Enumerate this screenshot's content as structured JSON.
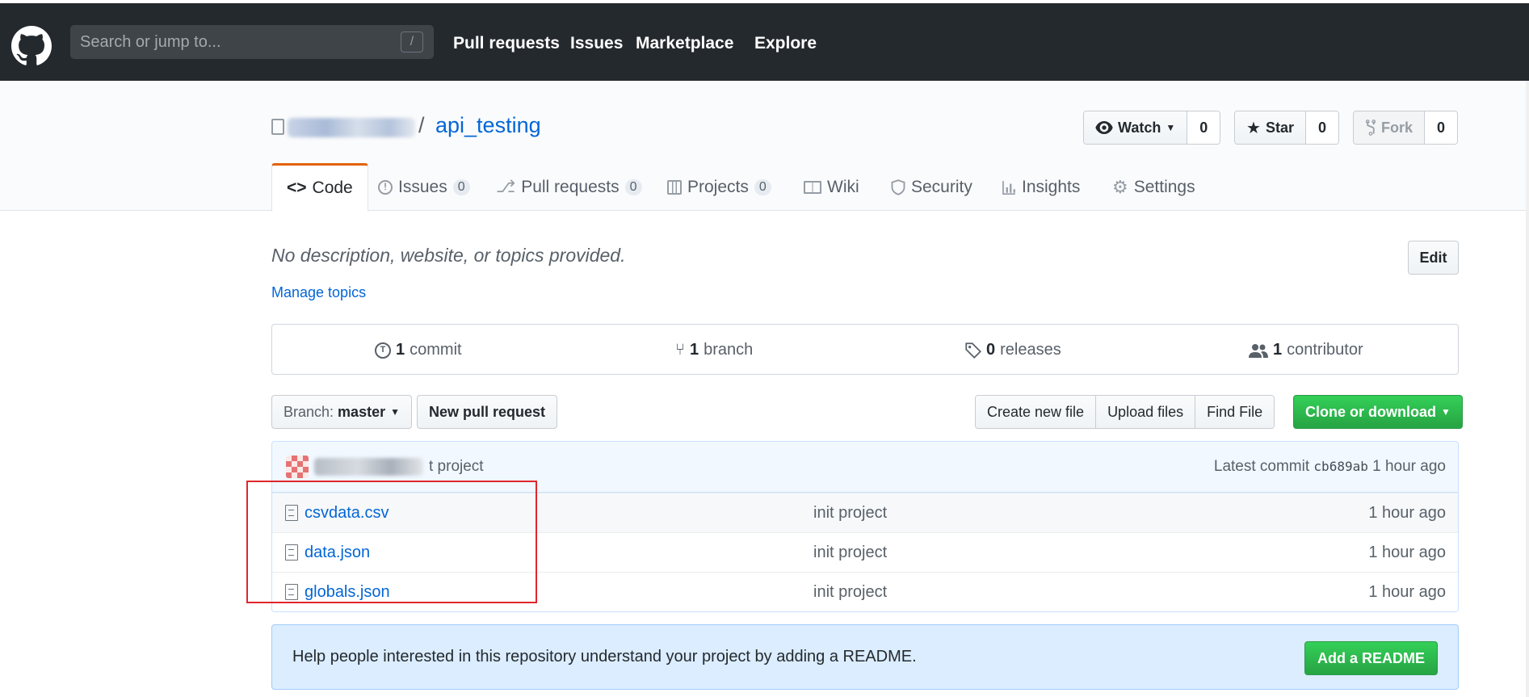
{
  "header": {
    "search_placeholder": "Search or jump to...",
    "search_shortcut": "/",
    "nav": [
      "Pull requests",
      "Issues",
      "Marketplace",
      "Explore"
    ]
  },
  "repo": {
    "separator": "/",
    "name": "api_testing",
    "watch": {
      "label": "Watch",
      "count": "0"
    },
    "star": {
      "label": "Star",
      "count": "0"
    },
    "fork": {
      "label": "Fork",
      "count": "0"
    }
  },
  "tabs": [
    {
      "label": "Code",
      "icon": "code-icon"
    },
    {
      "label": "Issues",
      "count": "0",
      "icon": "issue-icon"
    },
    {
      "label": "Pull requests",
      "count": "0",
      "icon": "pull-request-icon"
    },
    {
      "label": "Projects",
      "count": "0",
      "icon": "project-icon"
    },
    {
      "label": "Wiki",
      "icon": "book-icon"
    },
    {
      "label": "Security",
      "icon": "shield-icon"
    },
    {
      "label": "Insights",
      "icon": "graph-icon"
    },
    {
      "label": "Settings",
      "icon": "gear-icon"
    }
  ],
  "description": {
    "text": "No description, website, or topics provided.",
    "manage_topics": "Manage topics",
    "edit": "Edit"
  },
  "summary": {
    "commits": {
      "count": "1",
      "label": "commit"
    },
    "branches": {
      "count": "1",
      "label": "branch"
    },
    "releases": {
      "count": "0",
      "label": "releases"
    },
    "contributors": {
      "count": "1",
      "label": "contributor"
    }
  },
  "file_nav": {
    "branch_label": "Branch:",
    "branch_name": "master",
    "new_pull_request": "New pull request",
    "create_new_file": "Create new file",
    "upload_files": "Upload files",
    "find_file": "Find File",
    "clone_or_download": "Clone or download"
  },
  "latest_commit": {
    "message": "t project",
    "prefix": "Latest commit",
    "sha": "cb689ab",
    "age": "1 hour ago"
  },
  "files": [
    {
      "name": "csvdata.csv",
      "message": "init project",
      "age": "1 hour ago"
    },
    {
      "name": "data.json",
      "message": "init project",
      "age": "1 hour ago"
    },
    {
      "name": "globals.json",
      "message": "init project",
      "age": "1 hour ago"
    }
  ],
  "readme": {
    "text": "Help people interested in this repository understand your project by adding a README.",
    "button": "Add a README"
  },
  "colors": {
    "header_bg": "#24292e",
    "link": "#0366d6",
    "green": "#28a745",
    "selected_tab_accent": "#e36209",
    "annotation_red": "#e0262b"
  }
}
